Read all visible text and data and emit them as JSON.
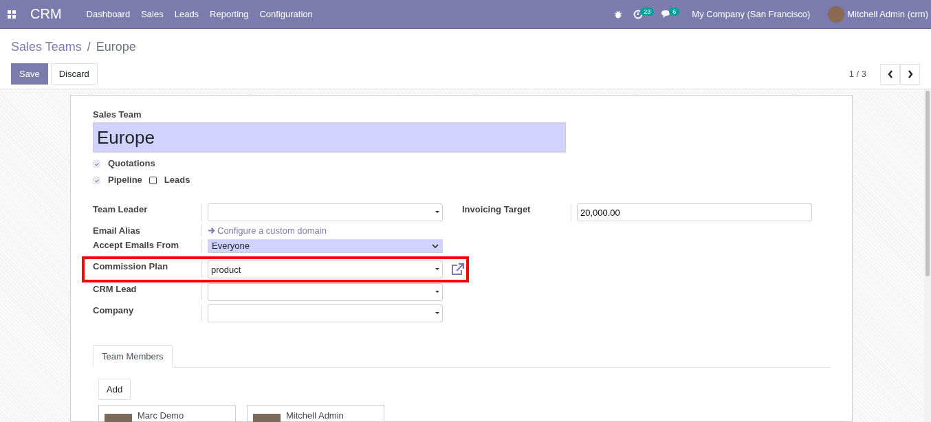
{
  "navbar": {
    "app_name": "CRM",
    "menu": [
      "Dashboard",
      "Sales",
      "Leads",
      "Reporting",
      "Configuration"
    ],
    "activity_count": "23",
    "message_count": "6",
    "company": "My Company (San Francisco)",
    "user": "Mitchell Admin (crm)"
  },
  "breadcrumb": {
    "parent": "Sales Teams",
    "separator": "/",
    "current": "Europe"
  },
  "buttons": {
    "save": "Save",
    "discard": "Discard"
  },
  "pager": {
    "value": "1 / 3"
  },
  "form": {
    "name_label": "Sales Team",
    "name": "Europe",
    "checkboxes": [
      {
        "label": "Quotations",
        "checked": true,
        "readonly": true
      },
      {
        "label": "Pipeline",
        "checked": true,
        "readonly": true
      },
      {
        "label": "Leads",
        "checked": false,
        "readonly": false
      }
    ],
    "left_fields": [
      {
        "label": "Team Leader",
        "kind": "dropdown",
        "highlighted": false
      },
      {
        "label": "Email Alias",
        "kind": "link",
        "value": "Configure a custom domain",
        "highlighted": false
      },
      {
        "label": "Accept Emails From",
        "kind": "select",
        "value": "Everyone",
        "highlighted": false
      },
      {
        "label": "Commission Plan",
        "kind": "dropdown",
        "value": "product",
        "external_link": true,
        "highlighted": true
      },
      {
        "label": "CRM Lead",
        "kind": "dropdown",
        "highlighted": false
      },
      {
        "label": "Company",
        "kind": "dropdown",
        "highlighted": false
      }
    ],
    "right_fields": [
      {
        "label": "Invoicing Target",
        "kind": "text",
        "value": "20,000.00"
      }
    ],
    "tabs": [
      {
        "label": "Team Members",
        "selected": true
      }
    ],
    "add_button": "Add",
    "members": [
      "Marc Demo",
      "Mitchell Admin"
    ]
  }
}
